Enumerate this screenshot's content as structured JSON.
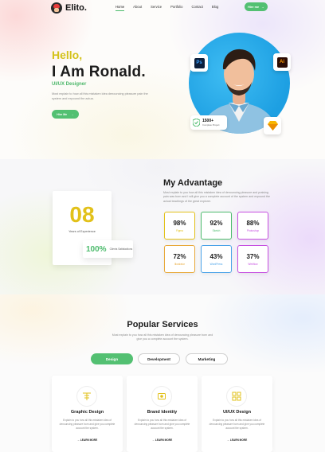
{
  "brand": {
    "name": "Elito."
  },
  "nav": {
    "items": [
      "Home",
      "About",
      "Service",
      "Portfolio",
      "Contact",
      "Blog"
    ],
    "active": "Home",
    "cta_label": "Hire me"
  },
  "hero": {
    "greeting": "Hello,",
    "name": "I Am Ronald.",
    "role": "UI/UX Designer",
    "description": "Most explain to how all this mistaken idea denouncing pleasure pain the system and expound the actua.",
    "cta_label": "Hire Me",
    "skill_badges": [
      {
        "icon": "photoshop-icon",
        "label": "Ps"
      },
      {
        "icon": "illustrator-icon",
        "label": "Ai"
      },
      {
        "icon": "sketch-icon",
        "label": ""
      }
    ],
    "projects": {
      "count": "1500+",
      "label": "Complete Project"
    }
  },
  "advantage": {
    "title": "My Advantage",
    "description": "Most explain to you how all this mistaken idea of denouncing pleasure and praising pain was born and I will give you a complete account of the system and expound the actual teachings of the great explorer.",
    "experience": {
      "value": "08",
      "label": "Years of Experience"
    },
    "satisfaction": {
      "value": "100%",
      "label": "Clients Satisfactions"
    },
    "stats": [
      {
        "value": "98%",
        "label": "Figma",
        "color": "#e2c11a"
      },
      {
        "value": "92%",
        "label": "Sketch",
        "color": "#4cbb6c"
      },
      {
        "value": "88%",
        "label": "Photoshop",
        "color": "#c64fe0"
      },
      {
        "value": "72%",
        "label": "Illustrator",
        "color": "#e8a93a"
      },
      {
        "value": "43%",
        "label": "WordPress",
        "color": "#4aa3e8"
      },
      {
        "value": "37%",
        "label": "Webflow",
        "color": "#c64fe0"
      }
    ]
  },
  "services": {
    "title": "Popular Services",
    "description": "Most explain to you how all this mistaken idea of denouncing pleasure born and give you a complete account the system.",
    "tabs": [
      {
        "label": "Design",
        "active": true
      },
      {
        "label": "Development",
        "active": false
      },
      {
        "label": "Marketing",
        "active": false
      }
    ],
    "cards": [
      {
        "icon": "graphic-design-icon",
        "title": "Graphic Design",
        "text": "Explain to you how all this mistaken idea of denouncing pleasure born and give you complete account the system.",
        "link": "LEARN MORE"
      },
      {
        "icon": "brand-identity-icon",
        "title": "Brand Identity",
        "text": "Explain to you how all this mistaken idea of denouncing pleasure born and give you complete account the system.",
        "link": "LEARN MORE"
      },
      {
        "icon": "ui-ux-design-icon",
        "title": "UI/UX Design",
        "text": "Explain to you how all this mistaken idea of denouncing pleasure born and give you complete account the system.",
        "link": "LEARN MORE"
      }
    ]
  },
  "colors": {
    "accent": "#53c072",
    "highlight": "#e2c11a",
    "dark": "#1b1b1b"
  }
}
